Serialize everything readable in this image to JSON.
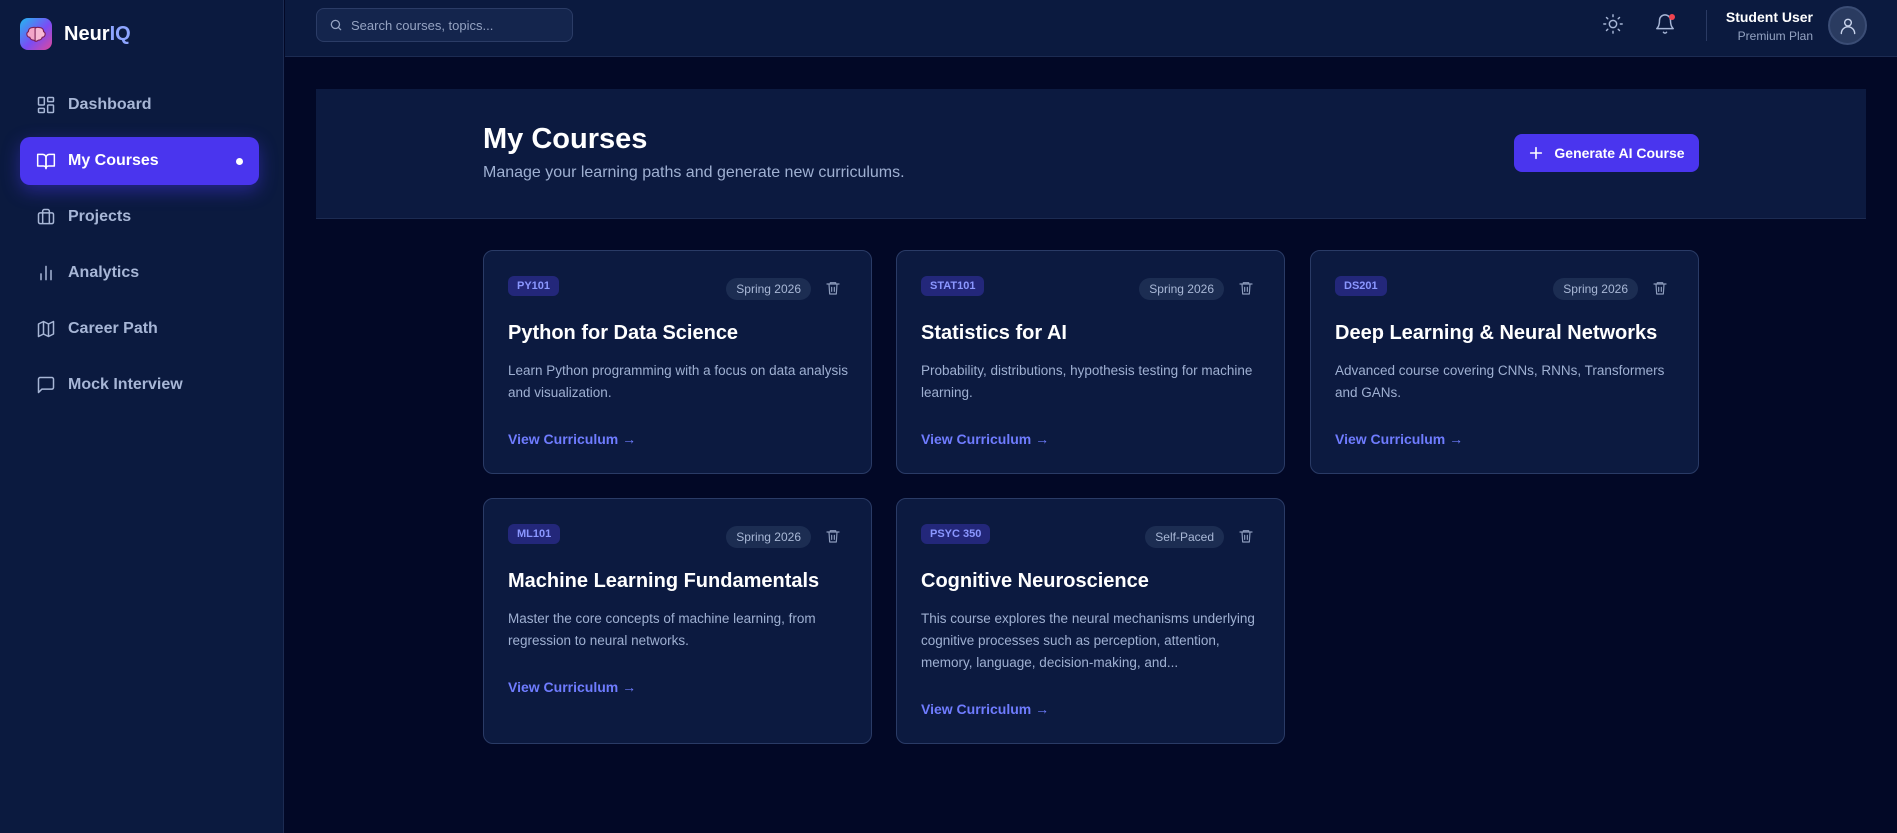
{
  "app": {
    "name_main": "Neur",
    "name_accent": "IQ"
  },
  "sidebar": {
    "items": [
      {
        "label": "Dashboard",
        "icon": "dashboard-icon",
        "active": false
      },
      {
        "label": "My Courses",
        "icon": "book-icon",
        "active": true
      },
      {
        "label": "Projects",
        "icon": "briefcase-icon",
        "active": false
      },
      {
        "label": "Analytics",
        "icon": "bar-chart-icon",
        "active": false
      },
      {
        "label": "Career Path",
        "icon": "map-icon",
        "active": false
      },
      {
        "label": "Mock Interview",
        "icon": "chat-icon",
        "active": false
      }
    ]
  },
  "topbar": {
    "search_placeholder": "Search courses, topics...",
    "user_name": "Student User",
    "user_plan": "Premium Plan"
  },
  "header": {
    "title": "My Courses",
    "subtitle": "Manage your learning paths and generate new curriculums.",
    "generate_label": "Generate AI Course"
  },
  "courses": [
    {
      "code": "PY101",
      "term": "Spring 2026",
      "title": "Python for Data Science",
      "description": "Learn Python programming with a focus on data analysis and visualization.",
      "link": "View Curriculum →"
    },
    {
      "code": "STAT101",
      "term": "Spring 2026",
      "title": "Statistics for AI",
      "description": "Probability, distributions, hypothesis testing for machine learning.",
      "link": "View Curriculum →"
    },
    {
      "code": "DS201",
      "term": "Spring 2026",
      "title": "Deep Learning & Neural Networks",
      "description": "Advanced course covering CNNs, RNNs, Transformers and GANs.",
      "link": "View Curriculum →"
    },
    {
      "code": "ML101",
      "term": "Spring 2026",
      "title": "Machine Learning Fundamentals",
      "description": "Master the core concepts of machine learning, from regression to neural networks.",
      "link": "View Curriculum →"
    },
    {
      "code": "PSYC 350",
      "term": "Self-Paced",
      "title": "Cognitive Neuroscience",
      "description": "This course explores the neural mechanisms underlying cognitive processes such as perception, attention, memory, language, decision-making, and...",
      "link": "View Curriculum →"
    }
  ],
  "colors": {
    "background": "#020826",
    "panel": "#0b1a3f",
    "accent": "#4a35ee",
    "link": "#6f7cff",
    "notification": "#f0434f"
  }
}
